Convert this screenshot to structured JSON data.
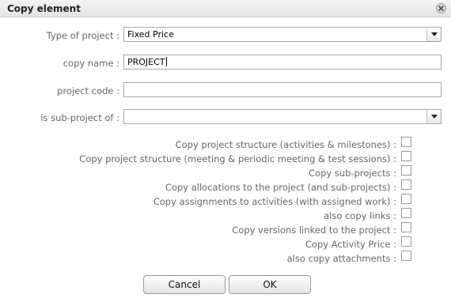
{
  "dialog": {
    "title": "Copy element"
  },
  "form": {
    "type_of_project": {
      "label": "Type of project :",
      "value": "Fixed Price"
    },
    "copy_name": {
      "label": "copy name :",
      "value": "PROJECT"
    },
    "project_code": {
      "label": "project code :",
      "value": ""
    },
    "sub_project_of": {
      "label": "is sub-project of :",
      "value": ""
    }
  },
  "options": [
    {
      "label": "Copy project structure (activities & milestones) :",
      "checked": false
    },
    {
      "label": "Copy project structure (meeting & periodic meeting & test sessions) :",
      "checked": false
    },
    {
      "label": "Copy sub-projects :",
      "checked": false
    },
    {
      "label": "Copy allocations to the project (and sub-projects) :",
      "checked": false
    },
    {
      "label": "Copy assignments to activities (with assigned work) :",
      "checked": false
    },
    {
      "label": "also copy links :",
      "checked": false
    },
    {
      "label": "Copy versions linked to the project :",
      "checked": false
    },
    {
      "label": "Copy Activity Price :",
      "checked": false
    },
    {
      "label": "also copy attachments :",
      "checked": false
    }
  ],
  "buttons": {
    "cancel": "Cancel",
    "ok": "OK"
  }
}
